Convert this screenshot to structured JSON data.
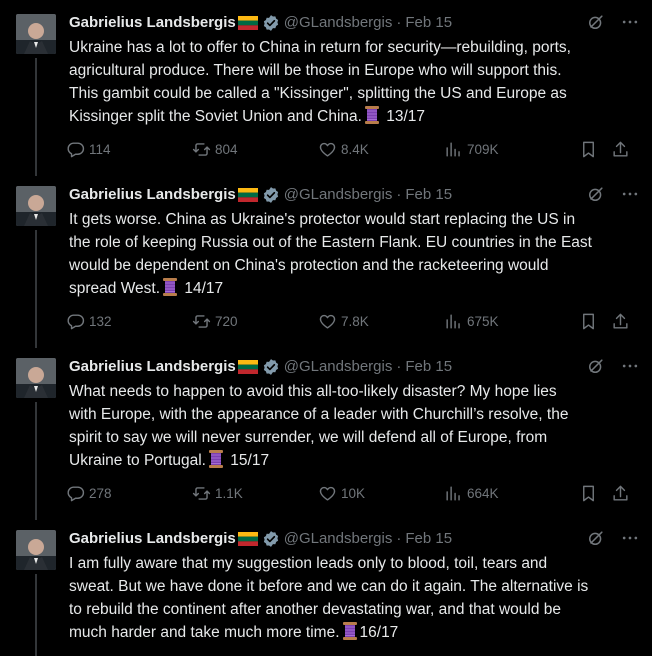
{
  "colors": {
    "background": "#000000",
    "text": "#e7e9ea",
    "muted": "#71767b",
    "verified": "#1d9bf0"
  },
  "tweets": [
    {
      "name": "Gabrielius Landsbergis",
      "handle": "@GLandsbergis",
      "date": "Feb 15",
      "text_lines": [
        "Ukraine has a lot to offer to China in return for security—rebuilding, ports,",
        "agricultural produce. There will be those in Europe who will support this.",
        "This gambit could be called a \"Kissinger\", splitting the US and Europe as",
        "Kissinger split the Soviet Union and China."
      ],
      "counter": " 13/17",
      "replies": "114",
      "reposts": "804",
      "likes": "8.4K",
      "views": "709K"
    },
    {
      "name": "Gabrielius Landsbergis",
      "handle": "@GLandsbergis",
      "date": "Feb 15",
      "text_lines": [
        "It gets worse. China as Ukraine's protector would start replacing the US in",
        "the role of keeping Russia out of the Eastern Flank. EU countries in the East",
        "would be dependent on China's protection and the racketeering would",
        "spread West."
      ],
      "counter": " 14/17",
      "replies": "132",
      "reposts": "720",
      "likes": "7.8K",
      "views": "675K"
    },
    {
      "name": "Gabrielius Landsbergis",
      "handle": "@GLandsbergis",
      "date": "Feb 15",
      "text_lines": [
        "What needs to happen to avoid this all-too-likely disaster? My hope lies",
        "with Europe, with the appearance of a leader with Churchill’s resolve, the",
        "spirit to say we will never surrender, we will defend all of Europe, from",
        "Ukraine to Portugal."
      ],
      "counter": " 15/17",
      "replies": "278",
      "reposts": "1.1K",
      "likes": "10K",
      "views": "664K"
    },
    {
      "name": "Gabrielius Landsbergis",
      "handle": "@GLandsbergis",
      "date": "Feb 15",
      "text_lines": [
        "I am fully aware that my suggestion leads only to blood, toil, tears and",
        "sweat. But we have done it before and we can do it again. The alternative is",
        "to rebuild the continent after another devastating war, and that would be",
        "much harder and take much more time."
      ],
      "counter": "16/17"
    }
  ]
}
